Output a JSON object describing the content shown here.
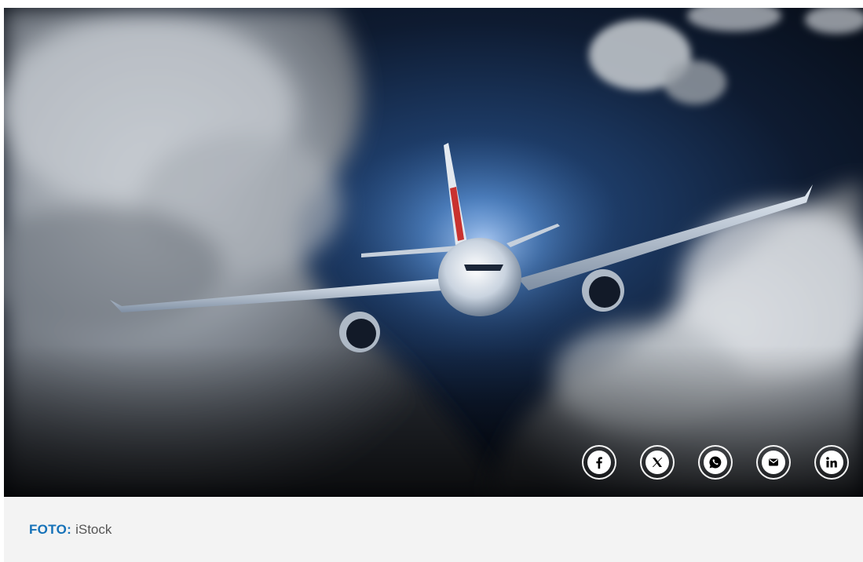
{
  "image": {
    "alt": ""
  },
  "share": {
    "buttons": [
      {
        "icon": "facebook-icon"
      },
      {
        "icon": "x-icon"
      },
      {
        "icon": "whatsapp-icon"
      },
      {
        "icon": "email-icon"
      },
      {
        "icon": "linkedin-icon"
      }
    ]
  },
  "caption": {
    "label": "FOTO:",
    "credit": "iStock"
  },
  "colors": {
    "caption_label": "#1471b8",
    "caption_bg": "#f3f3f3"
  }
}
